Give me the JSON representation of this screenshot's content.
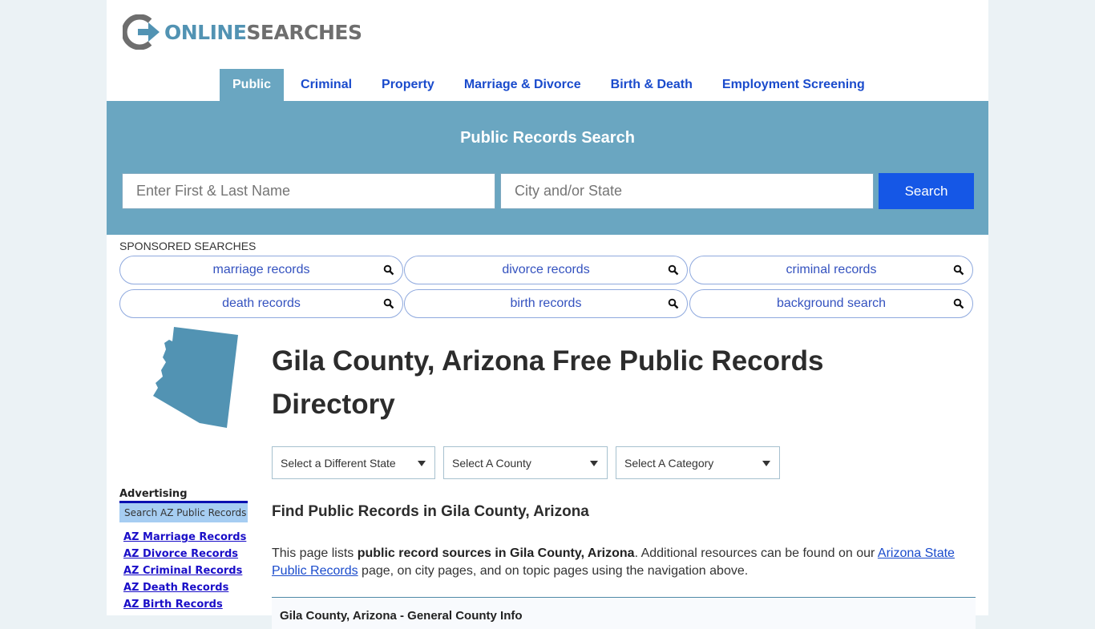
{
  "brand": {
    "logo_part1": "ONLINE",
    "logo_part2": "SEARCHES",
    "colors": {
      "accent": "#5293b3",
      "gray": "#6e6e6e",
      "banner": "#6aa6c1",
      "button": "#1557e6",
      "link": "#1a4bcc"
    }
  },
  "nav": {
    "items": [
      {
        "label": "Public",
        "active": true
      },
      {
        "label": "Criminal",
        "active": false
      },
      {
        "label": "Property",
        "active": false
      },
      {
        "label": "Marriage & Divorce",
        "active": false
      },
      {
        "label": "Birth & Death",
        "active": false
      },
      {
        "label": "Employment Screening",
        "active": false
      }
    ]
  },
  "search": {
    "title": "Public Records Search",
    "name_placeholder": "Enter First & Last Name",
    "location_placeholder": "City and/or State",
    "button_label": "Search"
  },
  "sponsored": {
    "label": "SPONSORED SEARCHES",
    "items": [
      {
        "label": "marriage records",
        "icon": "search-icon"
      },
      {
        "label": "divorce records",
        "icon": "search-icon"
      },
      {
        "label": "criminal records",
        "icon": "search-icon"
      },
      {
        "label": "death records",
        "icon": "search-icon"
      },
      {
        "label": "birth records",
        "icon": "search-icon"
      },
      {
        "label": "background search",
        "icon": "search-icon"
      }
    ]
  },
  "sidebar": {
    "state_icon": "arizona-map-icon",
    "advertising_label": "Advertising",
    "box_label": "Search AZ Public Records",
    "links": [
      "AZ Marriage Records",
      "AZ Divorce Records",
      "AZ Criminal Records",
      "AZ Death Records",
      "AZ Birth Records"
    ]
  },
  "main": {
    "title": "Gila County, Arizona Free Public Records Directory",
    "selects": [
      {
        "value": "Select a Different State"
      },
      {
        "value": "Select A County"
      },
      {
        "value": "Select A Category"
      }
    ],
    "subheading": "Find Public Records in Gila County, Arizona",
    "intro": {
      "t1": "This page lists ",
      "bold": "public record sources in Gila County, Arizona",
      "t2": ". Additional resources can be found on our ",
      "link": "Arizona State Public Records",
      "t3": " page, on city pages, and on topic pages using the navigation above."
    },
    "info_panel_title": "Gila County, Arizona - General County Info"
  }
}
